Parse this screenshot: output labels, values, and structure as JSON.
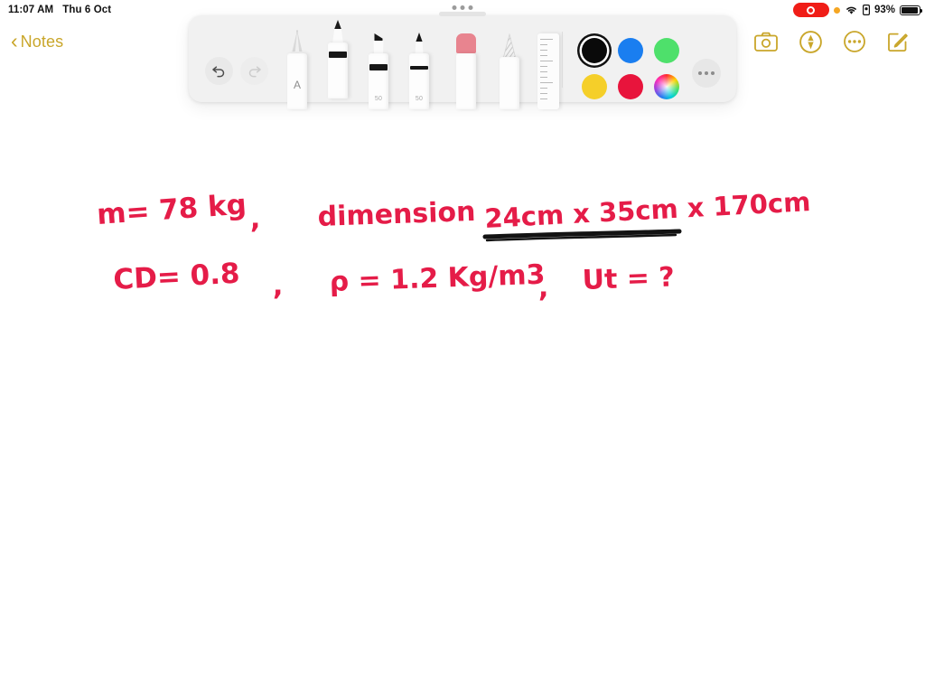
{
  "status_bar": {
    "time": "11:07 AM",
    "date": "Thu 6 Oct",
    "recording_indicator": "record-pill",
    "orange_dot": "microphone-in-use-dot",
    "wifi": "wifi-icon",
    "orientation_lock": "rotation-lock-icon",
    "battery_percent": "93%",
    "battery_level": 93
  },
  "nav": {
    "back_label": "Notes",
    "back_chevron": "chevron-left-icon",
    "actions": [
      {
        "name": "camera-icon",
        "label": "Camera"
      },
      {
        "name": "markup-icon",
        "label": "Markup"
      },
      {
        "name": "more-icon",
        "label": "More"
      },
      {
        "name": "compose-icon",
        "label": "Compose"
      }
    ],
    "accent_color": "#c9a62a"
  },
  "palette": {
    "grip": "drag-handle",
    "undo": {
      "label": "Undo",
      "icon": "undo-arrow-icon",
      "enabled": true
    },
    "redo": {
      "label": "Redo",
      "icon": "redo-arrow-icon",
      "enabled": false
    },
    "tools": [
      {
        "name": "fountain-pen",
        "label": "Fountain Pen",
        "badge": "A",
        "selected": false
      },
      {
        "name": "pen",
        "label": "Pen",
        "badge": "",
        "selected": true
      },
      {
        "name": "marker",
        "label": "Marker",
        "badge": "50",
        "selected": false
      },
      {
        "name": "highlighter-pen",
        "label": "Pen",
        "badge": "50",
        "selected": false
      },
      {
        "name": "eraser",
        "label": "Eraser",
        "badge": "",
        "selected": false
      },
      {
        "name": "pencil",
        "label": "Pencil",
        "badge": "",
        "selected": false
      },
      {
        "name": "ruler",
        "label": "Ruler",
        "badge": "",
        "selected": false
      }
    ],
    "colors": [
      {
        "name": "black",
        "hex": "#0a0a0a",
        "selected": true
      },
      {
        "name": "blue",
        "hex": "#1a7ef0",
        "selected": false
      },
      {
        "name": "green",
        "hex": "#4ee06b",
        "selected": false
      },
      {
        "name": "yellow",
        "hex": "#f5cf29",
        "selected": false
      },
      {
        "name": "red",
        "hex": "#e8143c",
        "selected": false
      },
      {
        "name": "color-picker",
        "hex": "rainbow",
        "selected": false
      }
    ],
    "more_label": "More Options"
  },
  "note": {
    "ink_color": "#e51c48",
    "underline_color": "#131313",
    "lines": [
      {
        "id": "line-1",
        "segments": [
          {
            "text": "m= 78 kg"
          },
          {
            "text": ","
          },
          {
            "text": "dimension"
          },
          {
            "text": "24cm x 35cm x 170cm",
            "underlined": true
          }
        ],
        "plain": "m= 78 kg ,   dimension   24cm x 35cm x 170cm"
      },
      {
        "id": "line-2",
        "segments": [
          {
            "text": "CD= 0.8"
          },
          {
            "text": ","
          },
          {
            "text": "ρ = 1.2 Kg/m3"
          },
          {
            "text": ","
          },
          {
            "text": "Ut = ?"
          }
        ],
        "plain": "CD= 0.8 ,   ρ = 1.2 Kg/m3 ,  Ut = ?"
      }
    ],
    "variables": {
      "mass": "78 kg",
      "dimensions": "24cm x 35cm x 170cm",
      "drag_coefficient": "0.8",
      "density": "1.2 Kg/m3",
      "unknown": "Ut = ?"
    }
  }
}
